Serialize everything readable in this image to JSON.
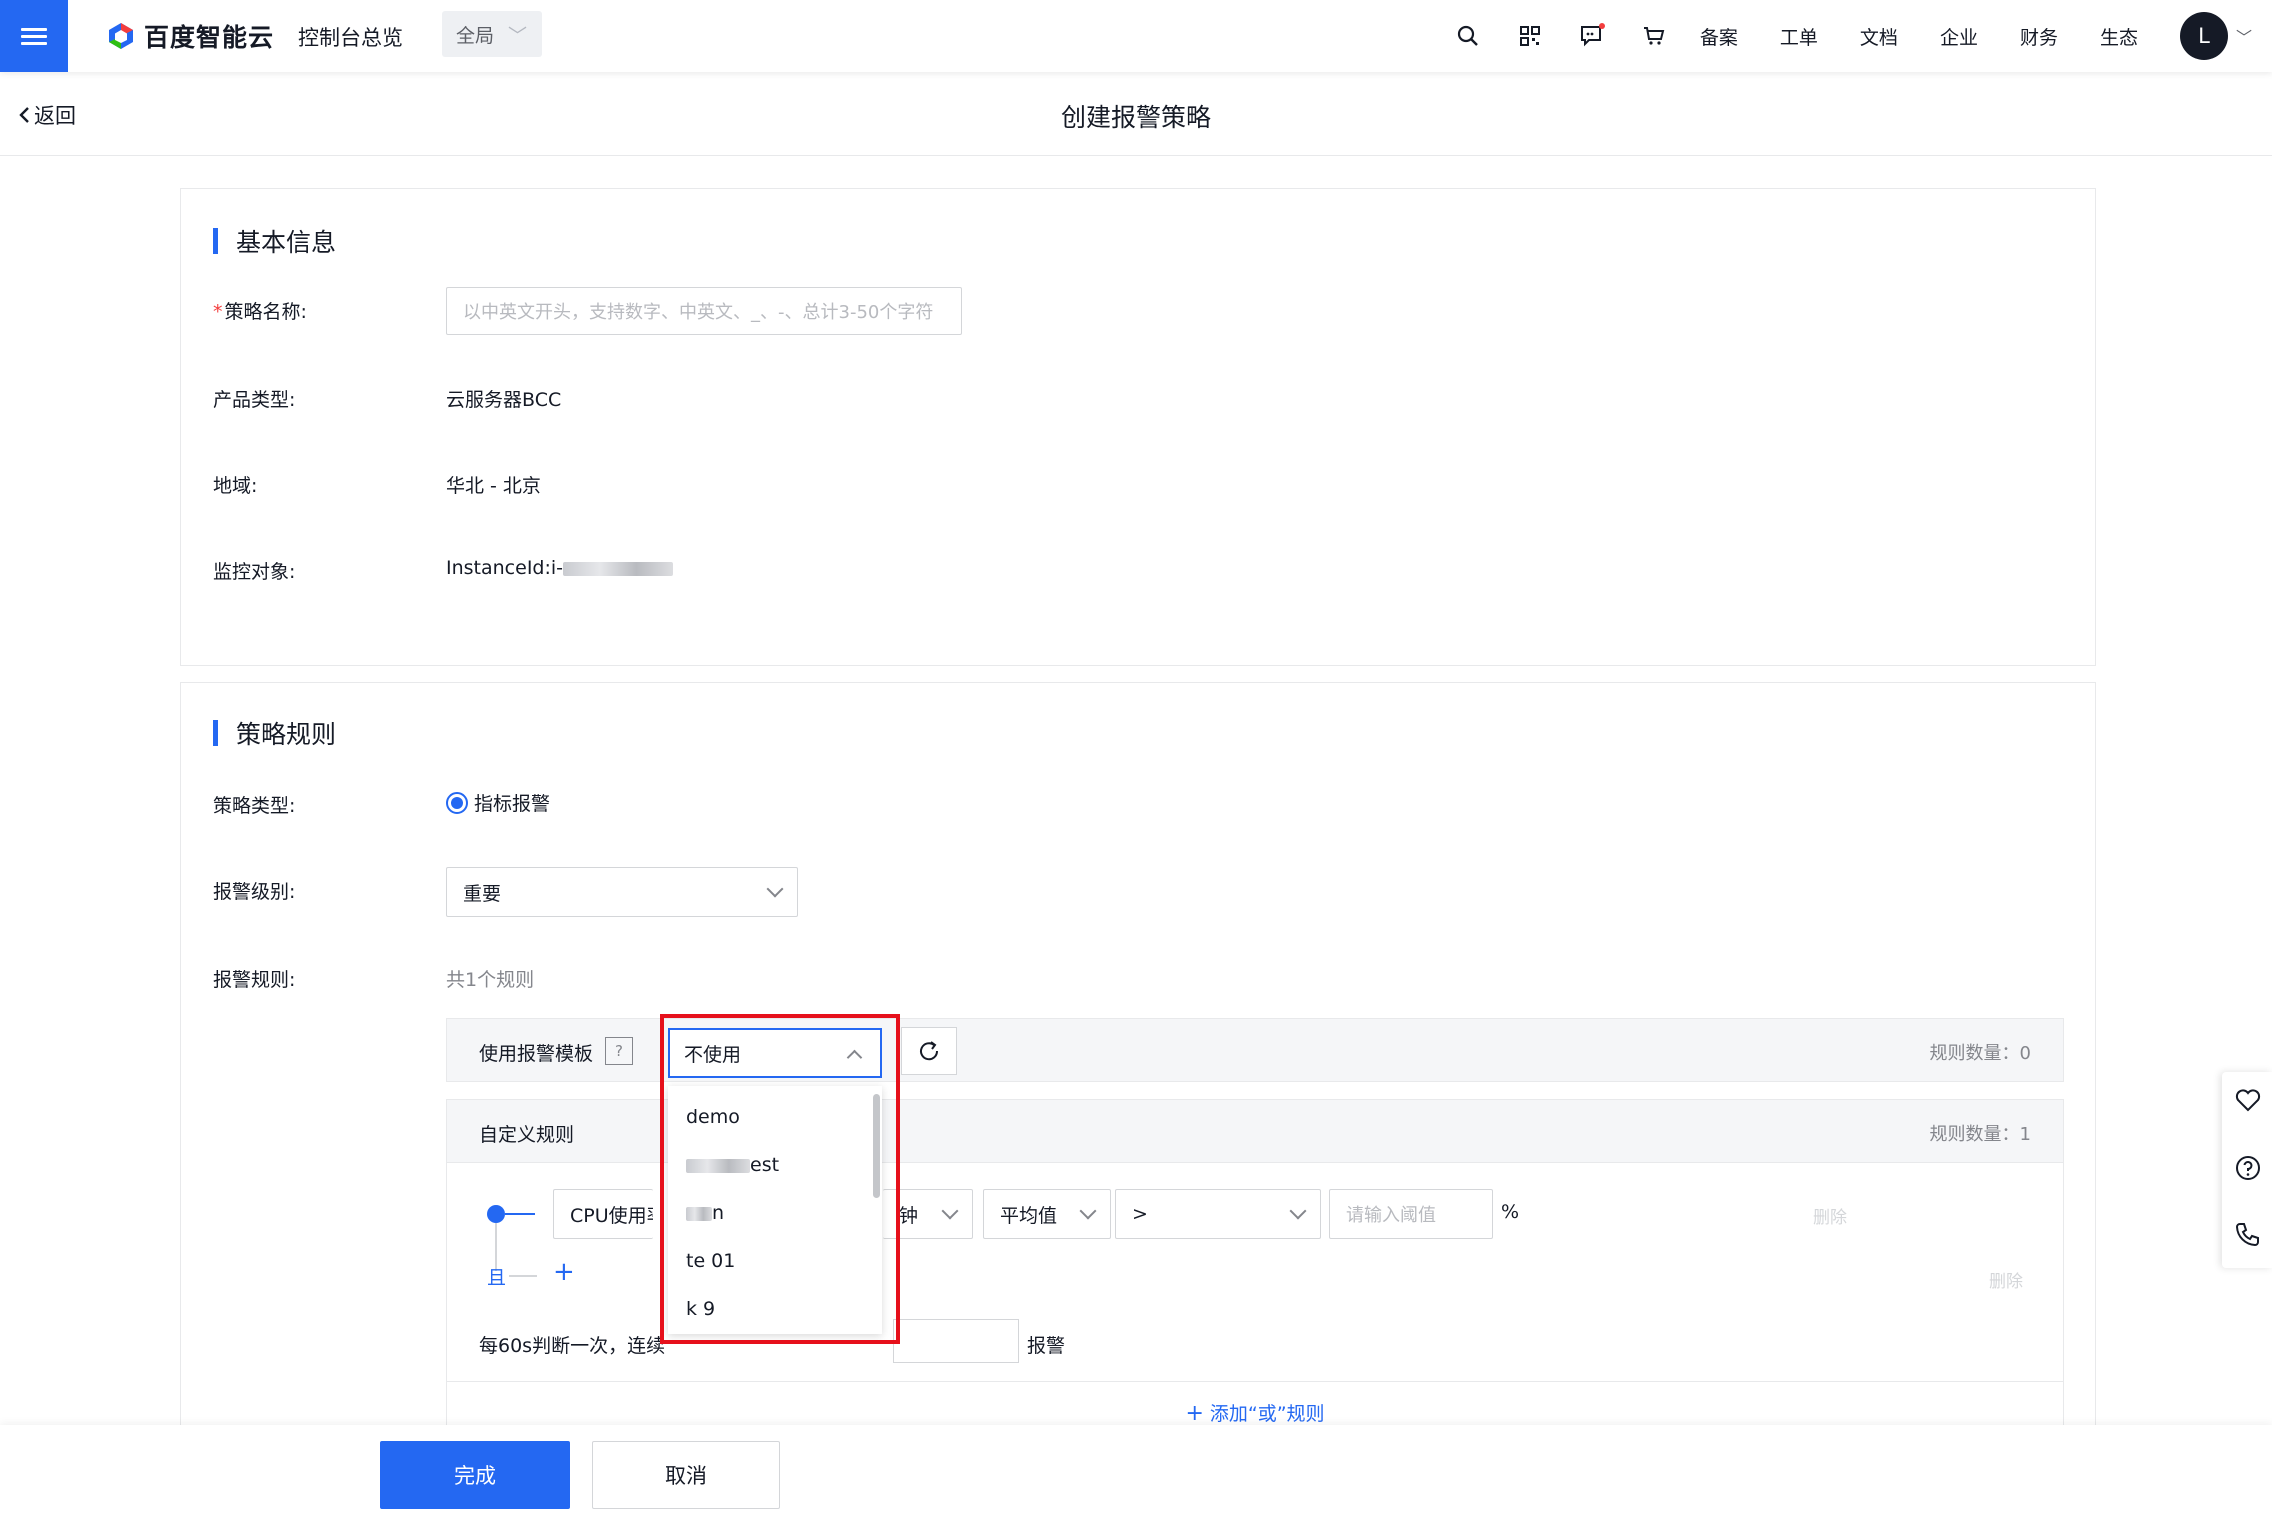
{
  "header": {
    "brand": "百度智能云",
    "console_home": "控制台总览",
    "scope": "全局",
    "links": [
      "备案",
      "工单",
      "文档",
      "企业",
      "财务",
      "生态"
    ],
    "avatar_initial": "L",
    "icons": [
      "search-icon",
      "qrcode-icon",
      "message-icon",
      "cart-icon"
    ]
  },
  "subheader": {
    "back": "返回",
    "title": "创建报警策略"
  },
  "basic": {
    "title": "基本信息",
    "name_label": "策略名称:",
    "name_placeholder": "以中英文开头，支持数字、中英文、_、-、总计3-50个字符",
    "product_label": "产品类型:",
    "product_value": "云服务器BCC",
    "region_label": "地域:",
    "region_value": "华北 - 北京",
    "target_label": "监控对象:",
    "target_value": "InstanceId:i-"
  },
  "rules": {
    "title": "策略规则",
    "type_label": "策略类型:",
    "type_option": "指标报警",
    "level_label": "报警级别:",
    "level_value": "重要",
    "rule_label": "报警规则:",
    "rule_count_text": "共1个规则",
    "template_label": "使用报警模板",
    "template_help": "?",
    "template_count": "规则数量：0",
    "custom_label": "自定义规则",
    "custom_count": "规则数量：1",
    "metric": "CPU使用率",
    "period_tail": "钟",
    "stat": "平均值",
    "operator": ">",
    "threshold_placeholder": "请输入阈值",
    "unit": "%",
    "delete": "删除",
    "delete2": "删除",
    "and_label": "且",
    "plus": "+",
    "judge_text": "每60s判断一次，连续",
    "judge_tail": "报警",
    "add_or": "添加“或”规则"
  },
  "dropdown": {
    "selected": "不使用",
    "items": [
      "demo",
      "est",
      "n",
      "te          01",
      "k          9"
    ]
  },
  "footer": {
    "done": "完成",
    "cancel": "取消"
  },
  "colors": {
    "accent": "#2468f2",
    "highlight": "#e6101b"
  }
}
